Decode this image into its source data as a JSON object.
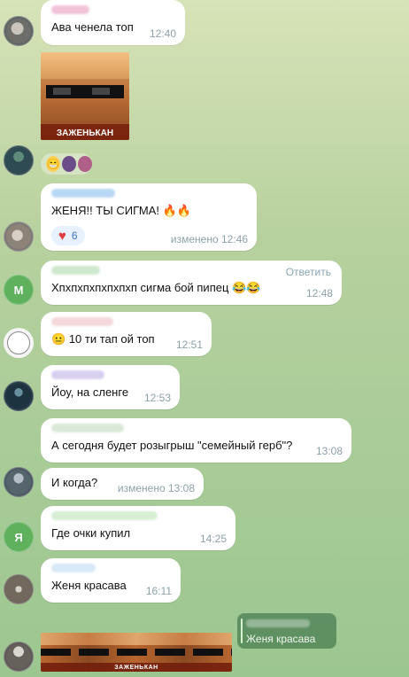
{
  "messages": [
    {
      "text": "Ава ченела топ",
      "time": "12:40"
    },
    {
      "sticker_caption": "ЗАЖЕНЬКАН"
    },
    {
      "text": "ЖЕНЯ!! ТЫ СИГМА!",
      "time": "изменено 12:46",
      "reaction_count": "6",
      "reaction_icon": "heart-icon",
      "emoji": "🔥🔥"
    },
    {
      "avatar_letter": "М",
      "text": "Хпхпхпхпхпхпхп сигма бой пипец",
      "time": "12:48",
      "reply_label": "Ответить",
      "emoji": "😂😂"
    },
    {
      "text": "10 ти тап ой топ",
      "time": "12:51"
    },
    {
      "text": "Йоу, на сленге",
      "time": "12:53"
    },
    {
      "text": "А сегодня будет розыгрыш \"семейный герб\"?",
      "time": "13:08"
    },
    {
      "text": "И когда?",
      "time": "изменено 13:08"
    },
    {
      "avatar_letter": "Я",
      "text": "Где очки купил",
      "time": "14:25"
    },
    {
      "text": "Женя красава",
      "time": "16:11"
    }
  ],
  "reply_preview": {
    "text": "Женя красава"
  },
  "sticker_strip": {
    "caption": "ЗАЖЕНЬКАН"
  },
  "colors": {
    "accent": "#5fb15e",
    "reply_accent": "#467b50",
    "muted_time": "#8da1a8"
  }
}
